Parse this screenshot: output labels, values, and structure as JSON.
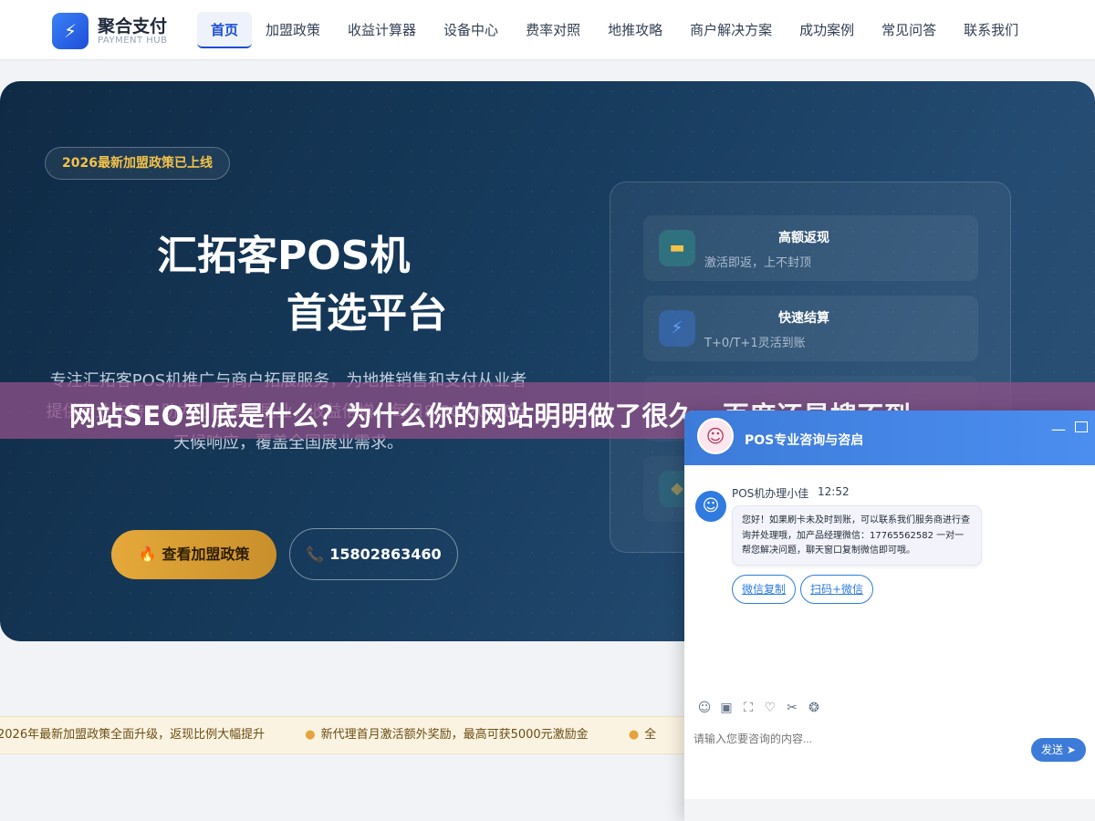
{
  "header": {
    "logo_icon": "⚡",
    "logo_name": "聚合支付",
    "logo_sub": "PAYMENT HUB",
    "nav": [
      {
        "label": "首页",
        "active": true
      },
      {
        "label": "加盟政策"
      },
      {
        "label": "收益计算器"
      },
      {
        "label": "设备中心"
      },
      {
        "label": "费率对照"
      },
      {
        "label": "地推攻略"
      },
      {
        "label": "商户解决方案"
      },
      {
        "label": "成功案例"
      },
      {
        "label": "常见问答"
      },
      {
        "label": "联系我们"
      }
    ]
  },
  "hero": {
    "badge": "2026最新加盟政策已上线",
    "title_line1": "汇拓客POS机",
    "title_line2": "首选平台",
    "description": "专注汇拓客POS机推广与商户拓展服务，为地推销售和支付从业者提供专业支持，助力团队高效展业，收益倍增。每日8:30-20:00全天候响应，覆盖全国展业需求。",
    "btn_policy": "查看加盟政策",
    "btn_policy_icon": "🔥",
    "btn_phone": "15802863460",
    "btn_phone_icon": "📞",
    "features": [
      {
        "icon": "card-icon",
        "glyph": "▬",
        "title": "高额返现",
        "sub": "激活即返，上不封顶"
      },
      {
        "icon": "lightning-icon",
        "glyph": "⚡",
        "title": "快速结算",
        "sub": "T+0/T+1灵活到账"
      }
    ]
  },
  "overlay": {
    "title": "网站SEO到底是什么？为什么你的网站明明做了很久，百度还是搜不到"
  },
  "ticker": {
    "items": [
      "2026年最新加盟政策全面升级，返现比例大幅提升",
      "新代理首月激活额外奖励，最高可获5000元激励金",
      "全"
    ]
  },
  "chat": {
    "header_title": "POS专业咨询与咨启",
    "minimize": "—",
    "agent_name": "POS机办理小佳",
    "agent_time": "12:52",
    "message": "您好！如果刷卡未及时到账，可以联系我们服务商进行查询并处理哦，加产品经理微信：17765562582 一对一帮您解决问题，聊天窗口复制微信即可哦。",
    "quick_buttons": [
      "微信复制",
      "扫码+微信"
    ],
    "tools": [
      "☺",
      "▣",
      "⛶",
      "♡",
      "✂",
      "❂"
    ],
    "input_placeholder": "请输入您要咨询的内容...",
    "send_label": "发送",
    "send_icon": "➤"
  },
  "colors": {
    "brand_blue": "#1d4ed8",
    "gold": "#e5a93a",
    "overlay": "#8c5087",
    "chat_blue": "#3d7bd9"
  }
}
